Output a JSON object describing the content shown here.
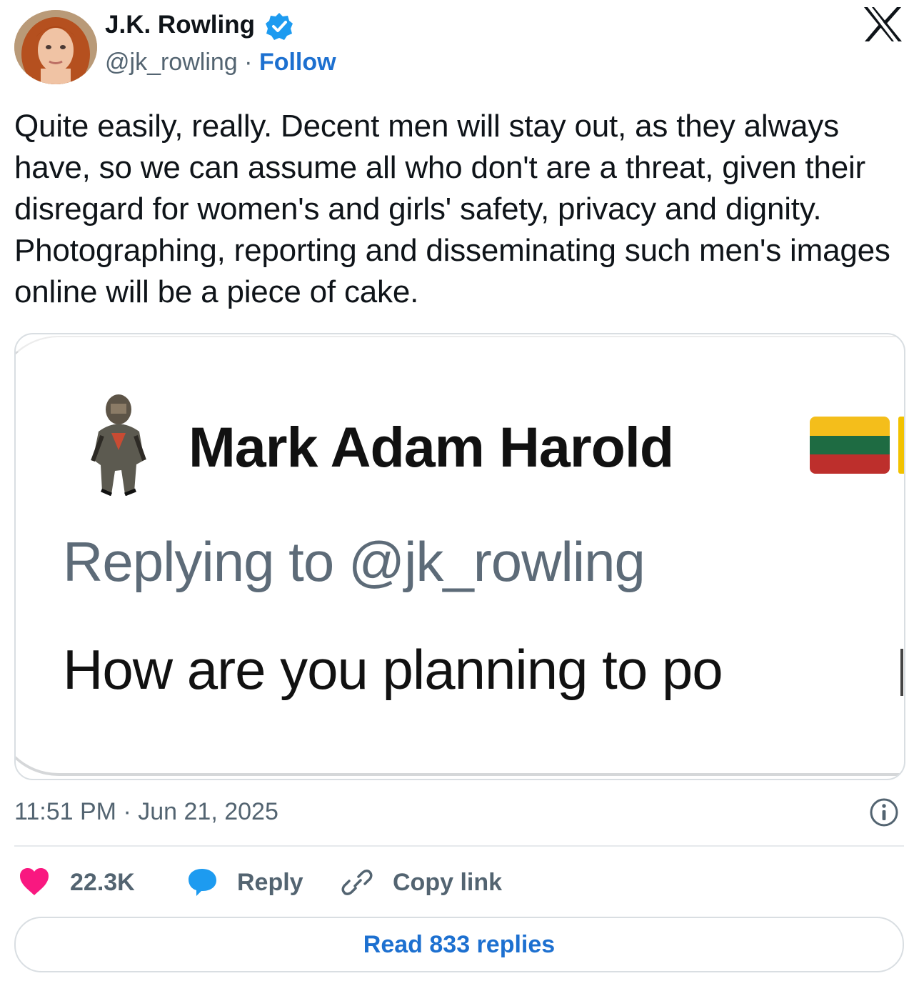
{
  "author": {
    "name": "J.K. Rowling",
    "handle": "@jk_rowling",
    "separator": "·",
    "follow_label": "Follow",
    "verified_icon": "verified-badge-icon",
    "verified_color": "#1d9bf0"
  },
  "platform_logo": "x-logo-icon",
  "tweet": {
    "text": "Quite easily, really. Decent men will stay out, as they always have, so we can assume all who don't are a threat, given their disregard for women's and girls' safety, privacy and dignity. Photographing, reporting and disseminating such men's images online will be a piece of cake."
  },
  "quoted_screenshot": {
    "name": "Mark Adam Harold",
    "replying_to": "Replying to @jk_rowling",
    "text": "How are you planning to po"
  },
  "meta": {
    "time": "11:51 PM",
    "separator": "·",
    "date": "Jun 21, 2025"
  },
  "actions": {
    "like_count": "22.3K",
    "reply_label": "Reply",
    "copy_label": "Copy link"
  },
  "read_replies_label": "Read 833 replies",
  "colors": {
    "like": "#f91880",
    "reply": "#1d9bf0",
    "link": "#1d70d0",
    "muted": "#536471"
  }
}
